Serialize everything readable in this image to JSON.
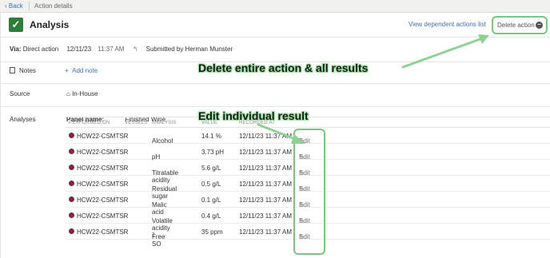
{
  "nav": {
    "back": "Back",
    "breadcrumb": "Action details"
  },
  "header": {
    "title": "Analysis",
    "dependent_link": "View dependent actions list",
    "delete_label": "Delete action"
  },
  "meta": {
    "via_label": "Via:",
    "via_value": "Direct action",
    "date": "12/11/23",
    "time": "11:37 AM",
    "submitted": "Submitted by Herman Munster"
  },
  "notes": {
    "label": "Notes",
    "add": "Add note"
  },
  "source": {
    "label": "Source",
    "value": "In-House"
  },
  "analyses": {
    "label": "Analyses",
    "panel_label": "Panel name:",
    "panel_value": "Finished Wine",
    "columns": [
      "PERFORMED ON",
      "VESSELS",
      "ANALYSIS",
      "VALUE",
      "RECORDED AT"
    ],
    "rows": [
      {
        "performed_on": "HCW22-CSMTSR",
        "analysis": "Alcohol",
        "value": "14.1 %",
        "recorded_at": "12/11/23 11:37 AM",
        "edit": "Edit"
      },
      {
        "performed_on": "HCW22-CSMTSR",
        "analysis": "pH",
        "value": "3.73 pH",
        "recorded_at": "12/11/23 11:37 AM",
        "edit": "Edit"
      },
      {
        "performed_on": "HCW22-CSMTSR",
        "analysis": "Titratable acidity",
        "value": "5.6 g/L",
        "recorded_at": "12/11/23 11:37 AM",
        "edit": "Edit"
      },
      {
        "performed_on": "HCW22-CSMTSR",
        "analysis": "Residual sugar",
        "value": "0.5 g/L",
        "recorded_at": "12/11/23 11:37 AM",
        "edit": "Edit"
      },
      {
        "performed_on": "HCW22-CSMTSR",
        "analysis": "Malic acid",
        "value": "0.1 g/L",
        "recorded_at": "12/11/23 11:37 AM",
        "edit": "Edit"
      },
      {
        "performed_on": "HCW22-CSMTSR",
        "analysis": "Volatile acidity",
        "value": "0.4 g/L",
        "recorded_at": "12/11/23 11:37 AM",
        "edit": "Edit"
      },
      {
        "performed_on": "HCW22-CSMTSR",
        "analysis": "Free SO",
        "analysis_sub": "2",
        "value": "35 ppm",
        "recorded_at": "12/11/23 11:37 AM",
        "edit": "Edit"
      }
    ]
  },
  "annotations": {
    "delete": "Delete entire action & all results",
    "edit": "Edit individual result"
  },
  "colors": {
    "accent": "#2f7d3a",
    "link": "#3f6fae",
    "highlight": "#7cc486",
    "vessel_dot": "#7a2a3c"
  },
  "icons": {
    "back": "chevron-left-icon",
    "check": "check-icon",
    "delete": "minus-circle-icon",
    "notes": "document-icon",
    "add": "plus-icon",
    "source": "home-icon",
    "undo": "undo-icon",
    "edit": "pencil-icon"
  }
}
